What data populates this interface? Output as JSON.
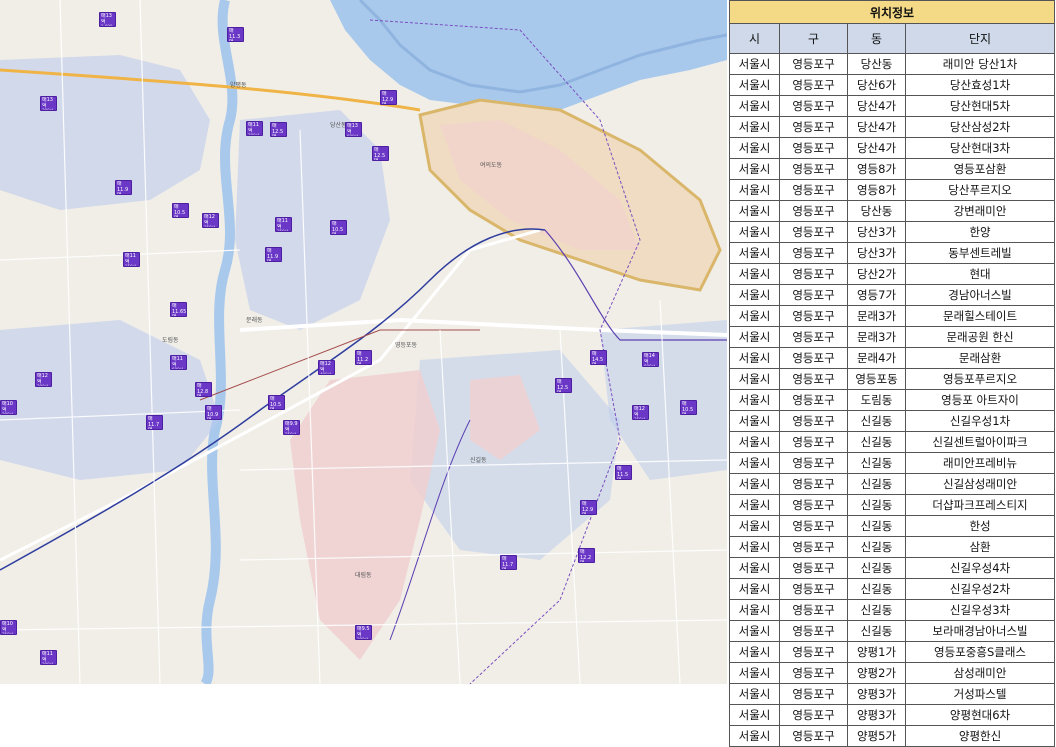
{
  "map": {
    "area_labels": [
      "당산동",
      "영등포동",
      "문래동",
      "신길동",
      "대림동",
      "도림동",
      "양평동",
      "여의도동"
    ],
    "markers": [
      {
        "price": "매13억",
        "sub": "1,000세대"
      },
      {
        "price": "매11.3억",
        "sub": "500세대"
      },
      {
        "price": "매12.9억",
        "sub": "800세대"
      },
      {
        "price": "매13억",
        "sub": "300세대"
      },
      {
        "price": "매11억",
        "sub": "200세대"
      },
      {
        "price": "매12.5억",
        "sub": "400세대"
      },
      {
        "price": "매13억",
        "sub": "600세대"
      },
      {
        "price": "매12.5억",
        "sub": "700세대"
      },
      {
        "price": "매10.5억",
        "sub": "300세대"
      },
      {
        "price": "매12억",
        "sub": "250세대"
      },
      {
        "price": "매11억",
        "sub": "350세대"
      },
      {
        "price": "매11.9억",
        "sub": "450세대"
      },
      {
        "price": "매11억",
        "sub": "150세대"
      },
      {
        "price": "매11.65억",
        "sub": "900세대"
      },
      {
        "price": "매10억",
        "sub": "200세대"
      },
      {
        "price": "매12억",
        "sub": "300세대"
      },
      {
        "price": "매11억",
        "sub": "600세대"
      },
      {
        "price": "매12.8억",
        "sub": "500세대"
      },
      {
        "price": "매10.9억",
        "sub": "300세대"
      },
      {
        "price": "매11.7억",
        "sub": "800세대"
      },
      {
        "price": "매9.9억",
        "sub": "250세대"
      },
      {
        "price": "매11.2억",
        "sub": "700세대"
      },
      {
        "price": "매12억",
        "sub": "400세대"
      },
      {
        "price": "매10.5억",
        "sub": "300세대"
      },
      {
        "price": "매14.5억",
        "sub": "900세대"
      },
      {
        "price": "매12.5억",
        "sub": "500세대"
      },
      {
        "price": "매14억",
        "sub": "600세대"
      },
      {
        "price": "매12억",
        "sub": "350세대"
      },
      {
        "price": "매11.5억",
        "sub": "450세대"
      },
      {
        "price": "매12.9억",
        "sub": "250세대"
      },
      {
        "price": "매10.5억",
        "sub": "300세대"
      },
      {
        "price": "매11.7억",
        "sub": "500세대"
      },
      {
        "price": "매12.2억",
        "sub": "400세대"
      },
      {
        "price": "매9.5억",
        "sub": "200세대"
      },
      {
        "price": "매10억",
        "sub": "350세대"
      },
      {
        "price": "매11억",
        "sub": "300세대"
      },
      {
        "price": "매10.5억",
        "sub": "250세대"
      },
      {
        "price": "매11.9억",
        "sub": "200세대"
      }
    ]
  },
  "table": {
    "title": "위치정보",
    "headers": [
      "시",
      "구",
      "동",
      "단지"
    ],
    "rows": [
      [
        "서울시",
        "영등포구",
        "당산동",
        "래미안 당산1차"
      ],
      [
        "서울시",
        "영등포구",
        "당산6가",
        "당산효성1차"
      ],
      [
        "서울시",
        "영등포구",
        "당산4가",
        "당산현대5차"
      ],
      [
        "서울시",
        "영등포구",
        "당산4가",
        "당산삼성2차"
      ],
      [
        "서울시",
        "영등포구",
        "당산4가",
        "당산현대3차"
      ],
      [
        "서울시",
        "영등포구",
        "영등8가",
        "영등포삼환"
      ],
      [
        "서울시",
        "영등포구",
        "영등8가",
        "당산푸르지오"
      ],
      [
        "서울시",
        "영등포구",
        "당산동",
        "강변래미안"
      ],
      [
        "서울시",
        "영등포구",
        "당산3가",
        "한양"
      ],
      [
        "서울시",
        "영등포구",
        "당산3가",
        "동부센트레빌"
      ],
      [
        "서울시",
        "영등포구",
        "당산2가",
        "현대"
      ],
      [
        "서울시",
        "영등포구",
        "영등7가",
        "경남아너스빌"
      ],
      [
        "서울시",
        "영등포구",
        "문래3가",
        "문래힐스테이트"
      ],
      [
        "서울시",
        "영등포구",
        "문래3가",
        "문래공원 한신"
      ],
      [
        "서울시",
        "영등포구",
        "문래4가",
        "문래삼환"
      ],
      [
        "서울시",
        "영등포구",
        "영등포동",
        "영등포푸르지오"
      ],
      [
        "서울시",
        "영등포구",
        "도림동",
        "영등포 아트자이"
      ],
      [
        "서울시",
        "영등포구",
        "신길동",
        "신길우성1차"
      ],
      [
        "서울시",
        "영등포구",
        "신길동",
        "신길센트럴아이파크"
      ],
      [
        "서울시",
        "영등포구",
        "신길동",
        "래미안프레비뉴"
      ],
      [
        "서울시",
        "영등포구",
        "신길동",
        "신길삼성래미안"
      ],
      [
        "서울시",
        "영등포구",
        "신길동",
        "더샵파크프레스티지"
      ],
      [
        "서울시",
        "영등포구",
        "신길동",
        "한성"
      ],
      [
        "서울시",
        "영등포구",
        "신길동",
        "삼환"
      ],
      [
        "서울시",
        "영등포구",
        "신길동",
        "신길우성4차"
      ],
      [
        "서울시",
        "영등포구",
        "신길동",
        "신길우성2차"
      ],
      [
        "서울시",
        "영등포구",
        "신길동",
        "신길우성3차"
      ],
      [
        "서울시",
        "영등포구",
        "신길동",
        "보라매경남아너스빌"
      ],
      [
        "서울시",
        "영등포구",
        "양평1가",
        "영등포중흥S클래스"
      ],
      [
        "서울시",
        "영등포구",
        "양평2가",
        "삼성래미안"
      ],
      [
        "서울시",
        "영등포구",
        "양평3가",
        "거성파스텔"
      ],
      [
        "서울시",
        "영등포구",
        "양평3가",
        "양평현대6차"
      ],
      [
        "서울시",
        "영등포구",
        "양평5가",
        "양평한신"
      ]
    ]
  },
  "colors": {
    "marker": "#6a37c6",
    "river": "#a9c9ec",
    "table_title_bg": "#f4da86",
    "table_head_bg": "#cfd9ea",
    "district_blue": "#b8c9ec",
    "district_pink": "#f0cfd0"
  }
}
